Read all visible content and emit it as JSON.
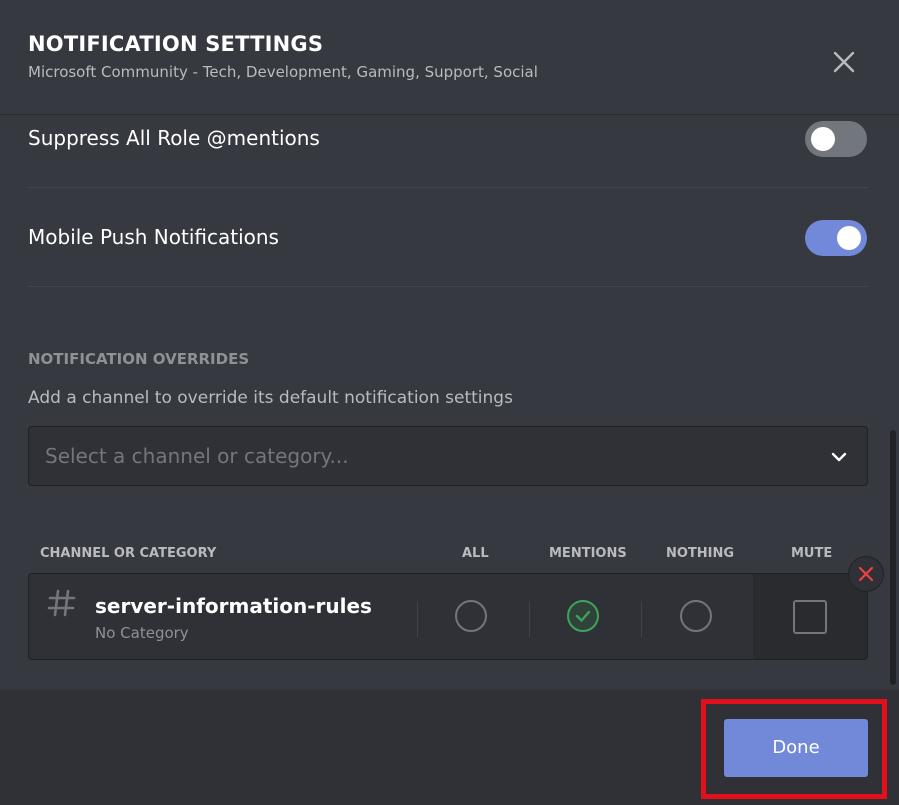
{
  "modal": {
    "title": "NOTIFICATION SETTINGS",
    "subtitle": "Microsoft Community - Tech, Development, Gaming, Support, Social",
    "close_icon": "close-icon"
  },
  "settings": [
    {
      "label": "Suppress All Role @mentions",
      "enabled": false
    },
    {
      "label": "Mobile Push Notifications",
      "enabled": true
    }
  ],
  "overrides": {
    "section_title": "NOTIFICATION OVERRIDES",
    "description": "Add a channel to override its default notification settings",
    "select_placeholder": "Select a channel or category...",
    "columns": [
      "CHANNEL OR CATEGORY",
      "ALL",
      "MENTIONS",
      "NOTHING",
      "MUTE"
    ],
    "rows": [
      {
        "channel": "server-information-rules",
        "category": "No Category",
        "selected": "MENTIONS",
        "mute": false
      }
    ]
  },
  "footer": {
    "done_label": "Done"
  },
  "colors": {
    "accent": "#7289da",
    "success": "#3ba55c",
    "danger": "#ed4245",
    "highlight": "#e3101c"
  }
}
